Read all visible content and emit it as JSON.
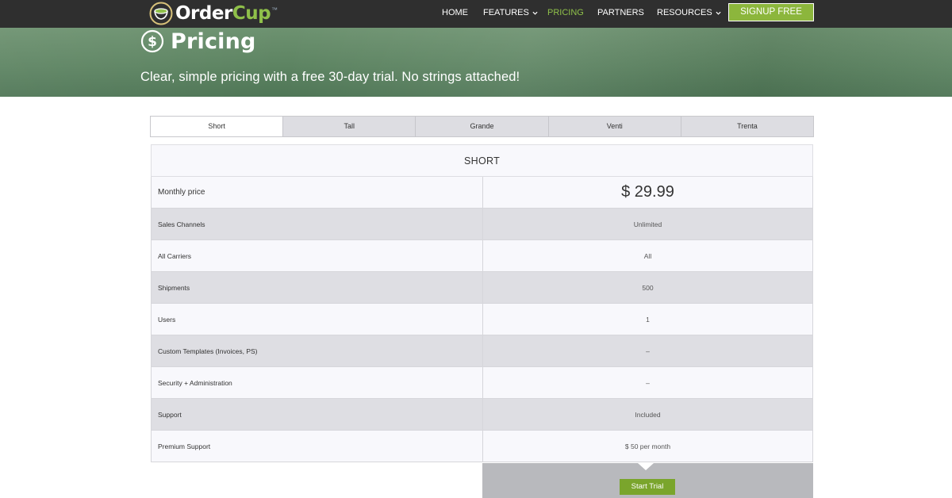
{
  "brand": {
    "name_part1": "Order",
    "name_part2": "Cup",
    "tm": "™"
  },
  "nav": {
    "home": "HOME",
    "features": "FEATURES",
    "pricing": "PRICING",
    "partners": "PARTNERS",
    "resources": "RESOURCES",
    "signup": "SIGNUP FREE"
  },
  "hero": {
    "title": "Pricing",
    "subtitle": "Clear, simple pricing with a free 30-day trial. No strings attached!"
  },
  "tabs": [
    "Short",
    "Tall",
    "Grande",
    "Venti",
    "Trenta"
  ],
  "plan": {
    "name": "SHORT",
    "price_label": "Monthly price",
    "price_value": "$ 29.99",
    "features": [
      {
        "label": "Sales Channels",
        "value": "Unlimited"
      },
      {
        "label": "All Carriers",
        "value": "All"
      },
      {
        "label": "Shipments",
        "value": "500"
      },
      {
        "label": "Users",
        "value": "1"
      },
      {
        "label": "Custom Templates (Invoices, PS)",
        "value": "–"
      },
      {
        "label": "Security + Administration",
        "value": "–"
      },
      {
        "label": "Support",
        "value": "Included"
      },
      {
        "label": "Premium Support",
        "value": "$ 50 per month"
      }
    ],
    "cta": "Start Trial"
  },
  "colors": {
    "topbar": "#2f2f2f",
    "accent_green": "#8fc04a",
    "button_green": "#7aa52c",
    "hero_green": "#5d8462"
  },
  "icons": {
    "logo": "coffee-cup-icon",
    "hero": "dollar-circle-icon",
    "dropdown": "chevron-down-icon"
  }
}
